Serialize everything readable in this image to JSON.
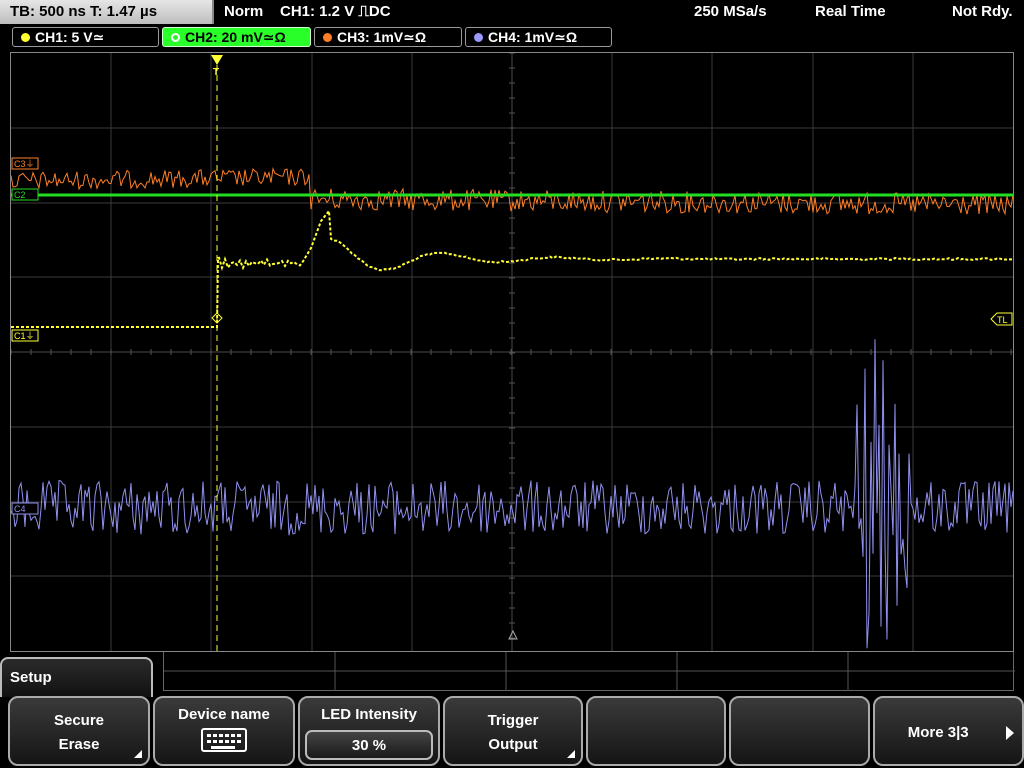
{
  "status_bar": {
    "timebase": "TB: 500 ns   T: 1.47 µs",
    "trigger_mode": "Norm",
    "trigger_info": "CH1: 1.2 V ⎍DC",
    "sample_rate": "250 MSa/s",
    "acq_mode": "Real Time",
    "state": "Not Rdy."
  },
  "channels": [
    {
      "label": "CH1: 5 V≃",
      "color": "#ffff33",
      "active": false
    },
    {
      "label": "CH2: 20 mV≃Ω",
      "color": "#33ee33",
      "active": true
    },
    {
      "label": "CH3: 1mV≃Ω",
      "color": "#ff7f27",
      "active": false
    },
    {
      "label": "CH4: 1mV≃Ω",
      "color": "#9999ff",
      "active": false
    }
  ],
  "plot": {
    "markers": {
      "c3": "C3⏚",
      "c1": "C1⏚",
      "c2": "C2",
      "c4": "C4",
      "tl": "TL",
      "trigger": "T"
    }
  },
  "menu": {
    "title": "Setup",
    "softkeys": [
      {
        "line1": "Secure",
        "line2": "Erase",
        "has_submenu": true
      },
      {
        "line1": "Device name",
        "icon": "keyboard-icon"
      },
      {
        "line1": "LED Intensity",
        "value": "30 %"
      },
      {
        "line1": "Trigger",
        "line2": "Output",
        "has_submenu": true
      },
      {
        "line1": ""
      },
      {
        "line1": ""
      },
      {
        "line1": "More 3|3"
      }
    ]
  }
}
